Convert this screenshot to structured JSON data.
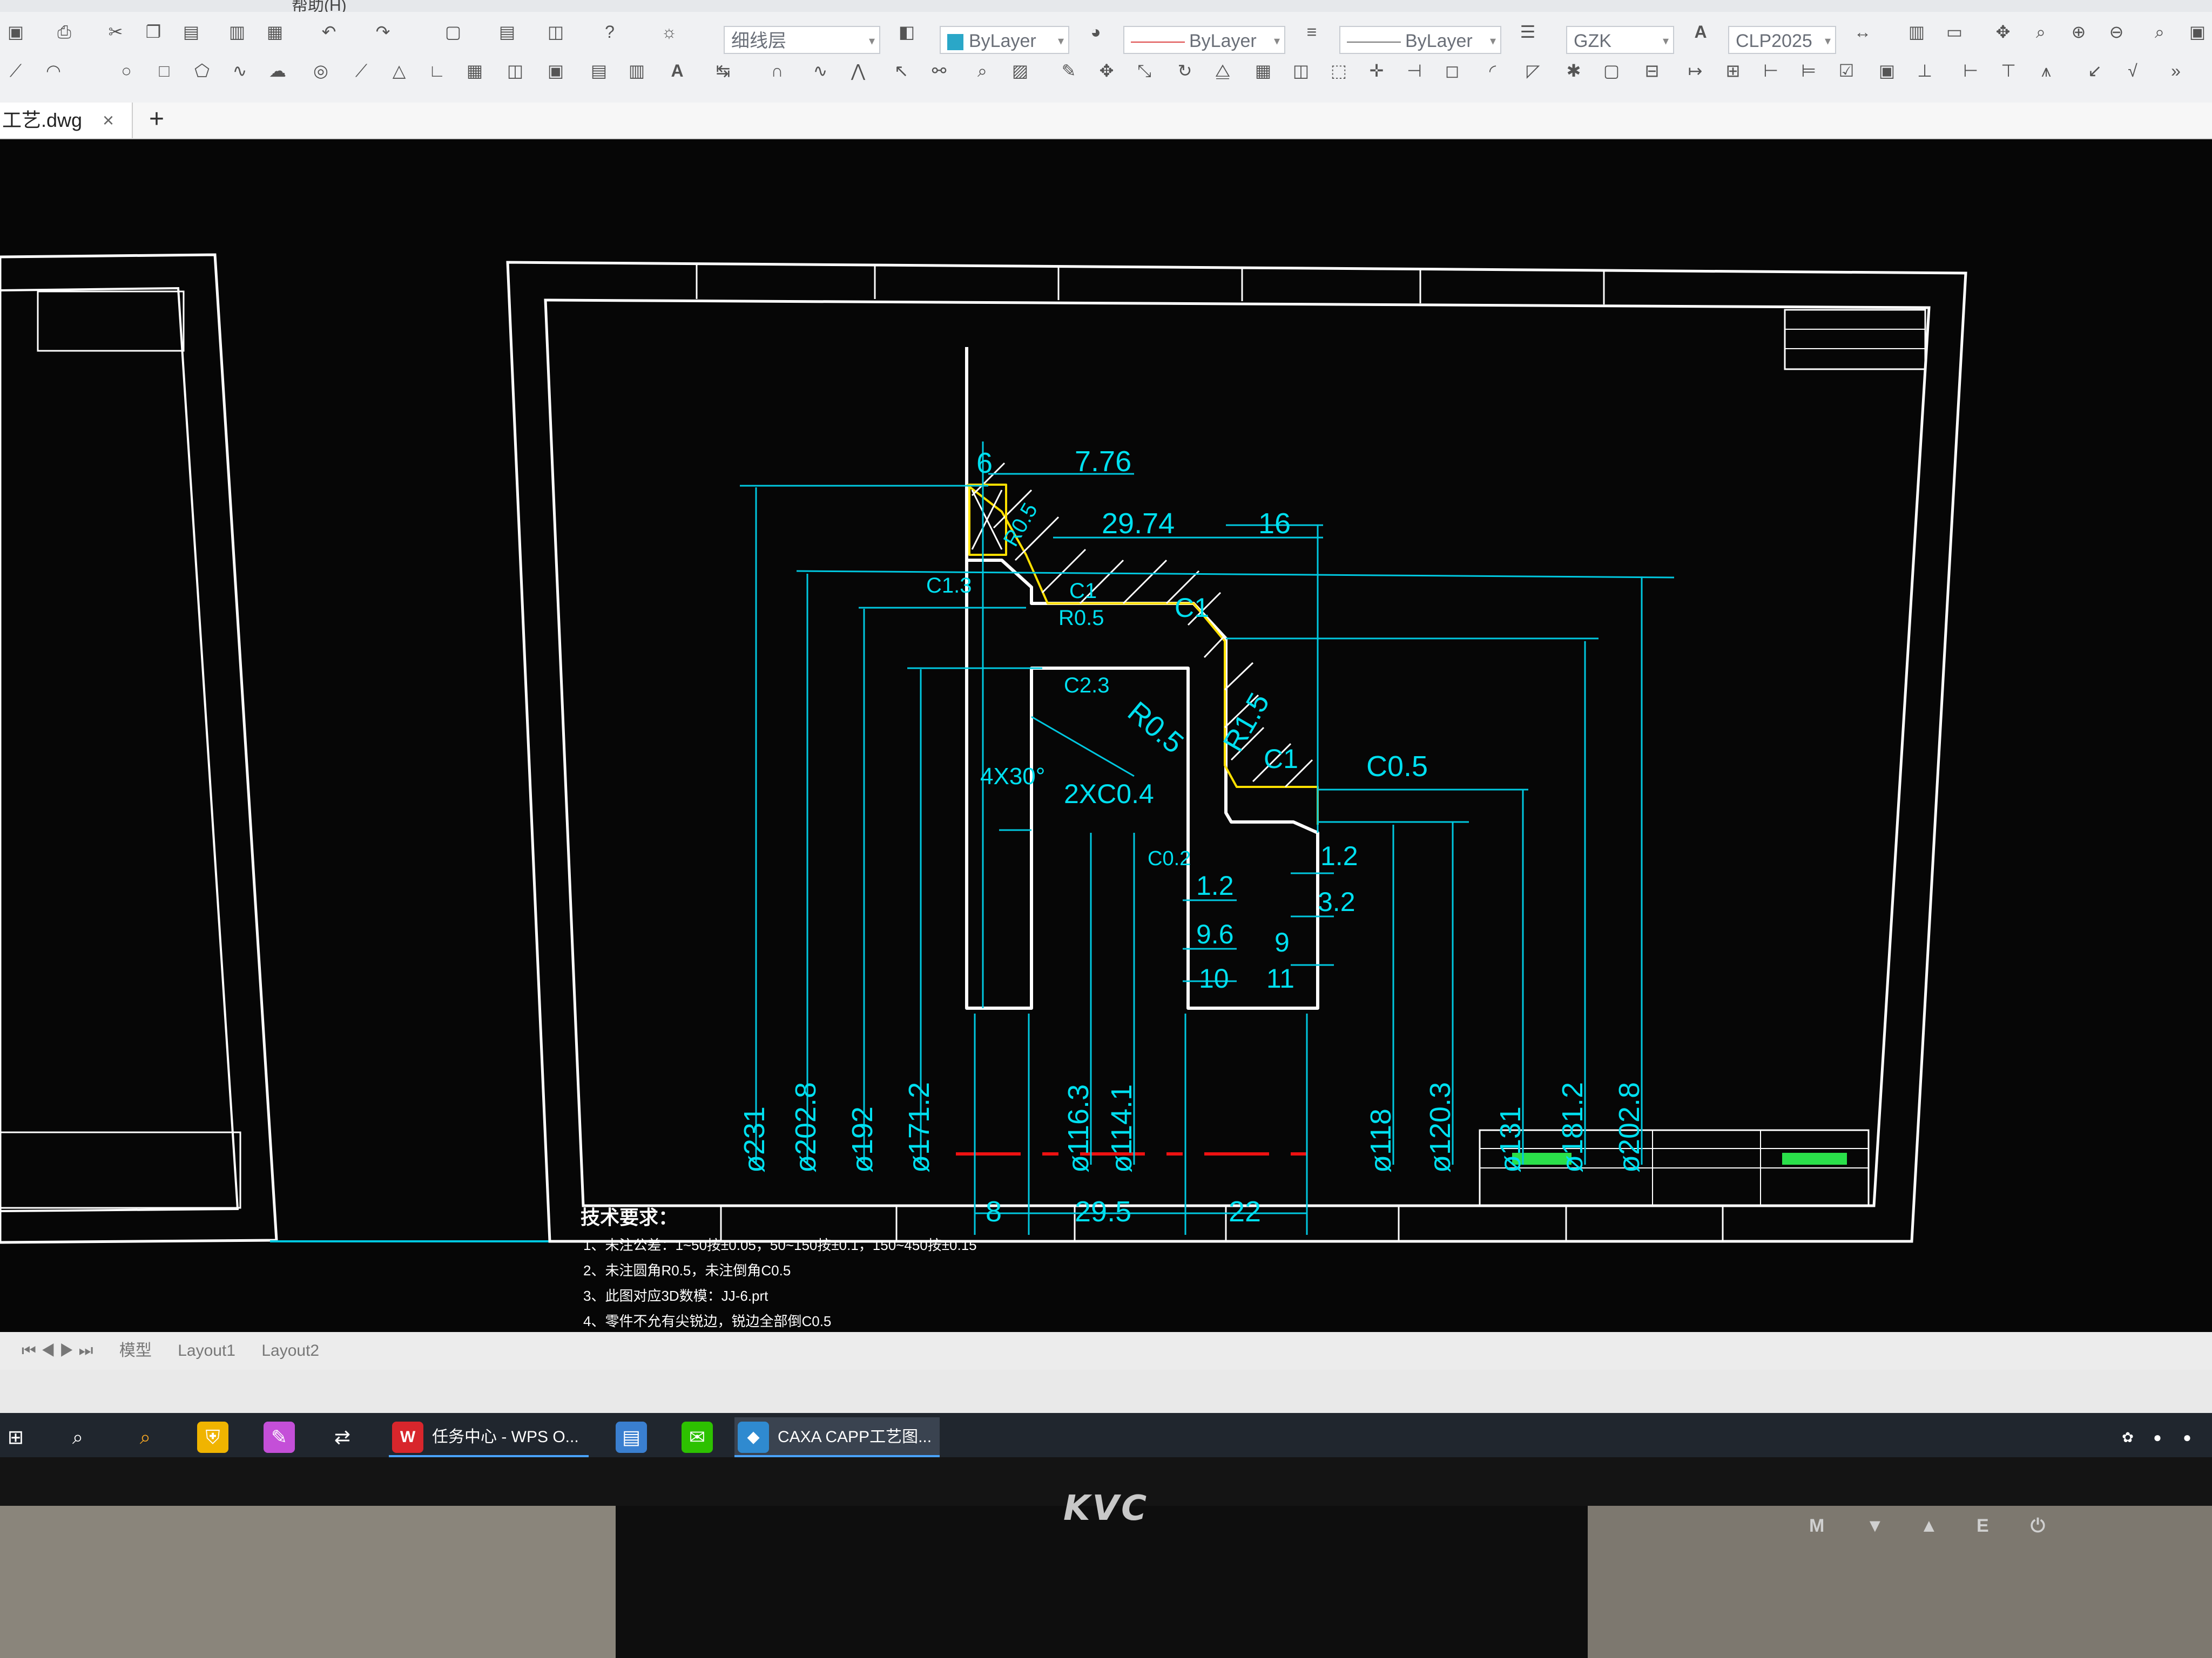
{
  "menu": {
    "items": [
      "",
      "",
      "",
      "",
      "",
      "",
      "",
      "",
      "帮助(H)"
    ]
  },
  "toolbar": {
    "layer_combo": "细线层",
    "color_combo": "ByLayer",
    "linetype_combo": "ByLayer",
    "lineweight_combo": "ByLayer",
    "textstyle_combo": "GZK",
    "dimstyle_combo": "CLP2025"
  },
  "tabs": {
    "file_label": "工艺.dwg",
    "close_glyph": "×",
    "add_glyph": "+"
  },
  "layouts": {
    "items": [
      "模型",
      "Layout1",
      "Layout2"
    ]
  },
  "taskbar": {
    "apps": [
      {
        "label": "任务中心 - WPS O..."
      },
      {
        "label": "CAXA CAPP工艺图..."
      }
    ]
  },
  "monitor": {
    "brand": "KVC",
    "buttons": [
      "M",
      "▼",
      "▲",
      "E",
      "⏻"
    ]
  },
  "drawing": {
    "dimensions": {
      "top_6": "6",
      "top_776": "7.76",
      "d2974": "29.74",
      "d16": "16",
      "c13": "C1.3",
      "c1a": "C1",
      "r05a": "R0.5",
      "r05b": "R0.5",
      "c1b": "C1",
      "c23": "C2.3",
      "r05c": "R0.5",
      "r15": "R1.5",
      "c1c": "C1",
      "c05": "C0.5",
      "angle": "4X30°",
      "ch2": "2XC0.4",
      "c02": "C0.2",
      "d12a": "1.2",
      "d12b": "1.2",
      "d32": "3.2",
      "d96": "9.6",
      "d9": "9",
      "d10": "10",
      "d11": "11",
      "b8": "8",
      "b295": "29.5",
      "b22": "22"
    },
    "diameters": [
      "ø231",
      "ø202.8",
      "ø192",
      "ø171.2",
      "ø116.3",
      "ø114.1",
      "ø118",
      "ø120.3",
      "ø131",
      "ø181.2",
      "ø202.8"
    ],
    "tech_req": {
      "title": "技术要求：",
      "lines": [
        "1、未注公差：1~50按±0.05，50~150按±0.1，150~450按±0.15",
        "2、未注圆角R0.5，未注倒角C0.5",
        "3、此图对应3D数模：JJ-6.prt",
        "4、零件不允有尖锐边，锐边全部倒C0.5"
      ]
    }
  }
}
